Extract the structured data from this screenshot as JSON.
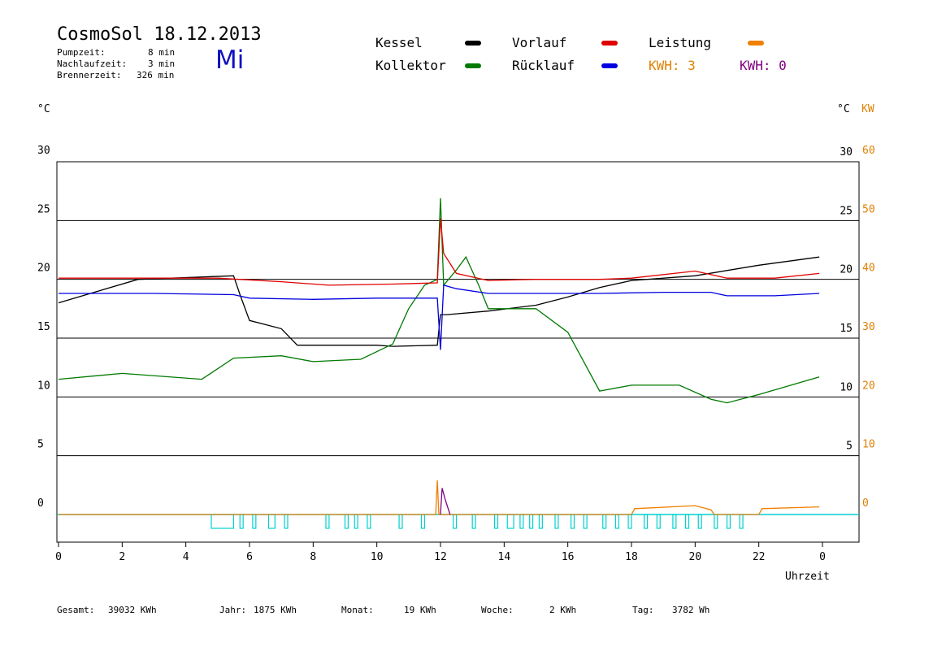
{
  "header": {
    "title": "CosmoSol 18.12.2013",
    "day": "Mi",
    "pumpzeit_label": "Pumpzeit:",
    "pumpzeit_value": "8 min",
    "nachlaufzeit_label": "Nachlaufzeit:",
    "nachlaufzeit_value": "3 min",
    "brennerzeit_label": "Brennerzeit:",
    "brennerzeit_value": "326 min"
  },
  "legend": {
    "kessel": "Kessel",
    "kollektor": "Kollektor",
    "vorlauf": "Vorlauf",
    "ruecklauf": "Rücklauf",
    "leistung": "Leistung",
    "kwh1": "KWH: 3",
    "kwh2": "KWH: 0"
  },
  "axis_units": {
    "left": "°C",
    "right_c": "°C",
    "right_kw": "KW",
    "x": "Uhrzeit"
  },
  "footer": {
    "gesamt_label": "Gesamt:",
    "gesamt_value": "39032 KWh",
    "jahr_label": "Jahr:",
    "jahr_value": "1875 KWh",
    "monat_label": "Monat:",
    "monat_value": "19 KWh",
    "woche_label": "Woche:",
    "woche_value": "2 KWh",
    "tag_label": "Tag:",
    "tag_value": "3782 Wh"
  },
  "colors": {
    "kessel": "#000000",
    "kollektor": "#007a00",
    "vorlauf": "#e00000",
    "ruecklauf": "#0000e0",
    "leistung": "#f08000",
    "kwh2": "#800080",
    "pumpe": "#00d0d0",
    "kw_axis": "#e08000"
  },
  "chart_data": {
    "type": "line",
    "x_range": [
      0,
      24
    ],
    "x_ticks": [
      "0",
      "2",
      "4",
      "6",
      "8",
      "10",
      "12",
      "14",
      "16",
      "18",
      "20",
      "22",
      "0"
    ],
    "y_left_ticks": [
      "0",
      "5",
      "10",
      "15",
      "20",
      "25",
      "30"
    ],
    "y_right_c_ticks": [
      "5",
      "10",
      "15",
      "20",
      "25",
      "30"
    ],
    "y_right_kw_ticks": [
      "0",
      "10",
      "20",
      "30",
      "40",
      "50",
      "60"
    ],
    "ylim_c": [
      0,
      30
    ],
    "ylim_kw": [
      0,
      60
    ],
    "grid": "horizontal",
    "series": [
      {
        "key": "kessel",
        "x": [
          0,
          2.5,
          5.5,
          5.7,
          6,
          7,
          7.5,
          7.7,
          10,
          10.5,
          11.9,
          12,
          12.2,
          13.5,
          15,
          16,
          17,
          18,
          20,
          22,
          23.9
        ],
        "y": [
          18,
          20,
          20.3,
          18.7,
          16.5,
          15.8,
          14.4,
          14.4,
          14.4,
          14.3,
          14.4,
          17,
          17,
          17.3,
          17.8,
          18.5,
          19.3,
          19.9,
          20.3,
          21.2,
          21.9
        ]
      },
      {
        "key": "kollektor",
        "x": [
          0,
          2,
          4.5,
          5.5,
          7,
          8,
          9.5,
          10.5,
          11,
          11.5,
          11.9,
          12,
          12.1,
          12.5,
          12.8,
          13.2,
          13.5,
          15,
          16,
          17,
          18,
          19.5,
          20.5,
          21,
          22,
          23.9
        ],
        "y": [
          11.5,
          12,
          11.5,
          13.3,
          13.5,
          13,
          13.2,
          14.5,
          17.5,
          19.5,
          20,
          26.9,
          19.5,
          20.8,
          21.9,
          19.5,
          17.5,
          17.5,
          15.5,
          10.5,
          11,
          11,
          9.8,
          9.5,
          10.2,
          11.7
        ]
      },
      {
        "key": "vorlauf",
        "x": [
          0,
          2.5,
          5,
          7,
          8.5,
          10.5,
          11.9,
          12,
          12.1,
          12.5,
          13.5,
          15,
          17,
          18,
          20,
          21,
          22.5,
          23.9
        ],
        "y": [
          20.1,
          20.1,
          20.1,
          19.8,
          19.5,
          19.6,
          19.7,
          25.2,
          22.2,
          20.5,
          19.9,
          20,
          20,
          20.1,
          20.7,
          20.1,
          20.1,
          20.5
        ]
      },
      {
        "key": "ruecklauf",
        "x": [
          0,
          3,
          5.5,
          6,
          8,
          10,
          11.9,
          12,
          12.1,
          12.5,
          13.5,
          15,
          17,
          19,
          20.5,
          21,
          22.5,
          23.9
        ],
        "y": [
          18.8,
          18.8,
          18.7,
          18.4,
          18.3,
          18.4,
          18.4,
          14,
          19.5,
          19.2,
          18.8,
          18.8,
          18.8,
          18.9,
          18.9,
          18.6,
          18.6,
          18.8
        ]
      },
      {
        "key": "leistung_kw",
        "x": [
          0,
          11.85,
          11.9,
          11.95,
          12.0,
          12.05,
          18,
          18.1,
          20,
          20.5,
          20.6,
          22,
          22.1,
          23.9
        ],
        "y": [
          0,
          0,
          5.8,
          0,
          0,
          0,
          0,
          1,
          1.5,
          0.8,
          0,
          0,
          1,
          1.3
        ]
      }
    ],
    "pump_cycles": [
      [
        4.8,
        5.5
      ],
      [
        5.7,
        5.8
      ],
      [
        6.1,
        6.2
      ],
      [
        6.6,
        6.8
      ],
      [
        7.1,
        7.2
      ],
      [
        8.4,
        8.5
      ],
      [
        9,
        9.1
      ],
      [
        9.3,
        9.4
      ],
      [
        9.7,
        9.8
      ],
      [
        10.7,
        10.8
      ],
      [
        11.4,
        11.5
      ],
      [
        12.4,
        12.5
      ],
      [
        13,
        13.1
      ],
      [
        13.7,
        13.8
      ],
      [
        14.1,
        14.3
      ],
      [
        14.5,
        14.6
      ],
      [
        14.8,
        14.9
      ],
      [
        15.1,
        15.2
      ],
      [
        15.6,
        15.7
      ],
      [
        16.1,
        16.2
      ],
      [
        16.5,
        16.6
      ],
      [
        17.1,
        17.2
      ],
      [
        17.5,
        17.6
      ],
      [
        17.9,
        18.0
      ],
      [
        18.4,
        18.5
      ],
      [
        18.8,
        18.9
      ],
      [
        19.3,
        19.4
      ],
      [
        19.7,
        19.8
      ],
      [
        20.1,
        20.2
      ],
      [
        20.6,
        20.7
      ],
      [
        21.0,
        21.1
      ],
      [
        21.4,
        21.5
      ]
    ]
  }
}
